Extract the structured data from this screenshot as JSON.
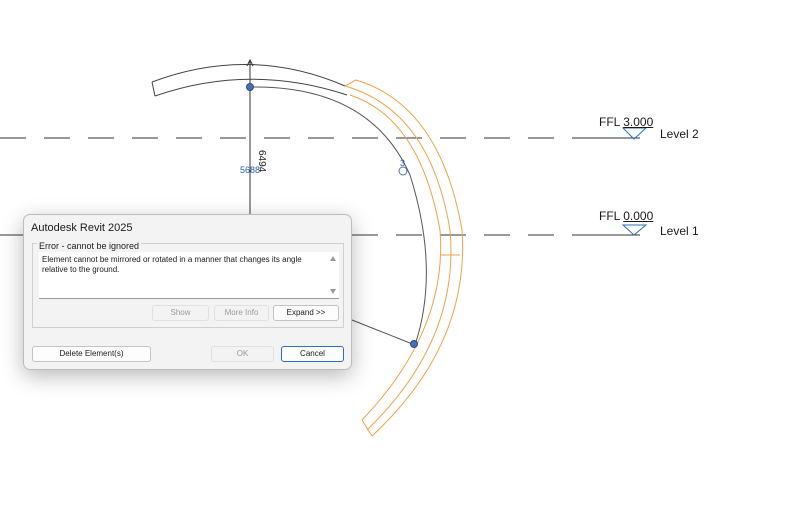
{
  "levels": [
    {
      "ffl_label": "FFL",
      "elevation": "3.000",
      "name": "Level 2"
    },
    {
      "ffl_label": "FFL",
      "elevation": "0.000",
      "name": "Level 1"
    }
  ],
  "dimension": {
    "value": "6494",
    "temp_value": "5688"
  },
  "grip_number": "3",
  "dialog": {
    "title": "Autodesk Revit 2025",
    "group_label": "Error - cannot be ignored",
    "message": "Element cannot be mirrored or rotated in a manner that changes its angle relative to the ground.",
    "buttons": {
      "show": "Show",
      "more_info": "More Info",
      "expand": "Expand >>",
      "delete": "Delete Element(s)",
      "ok": "OK",
      "cancel": "Cancel"
    }
  },
  "colors": {
    "accent": "#2c6fc1",
    "highlight": "#f0a24a",
    "grip": "#4a6fb5"
  }
}
